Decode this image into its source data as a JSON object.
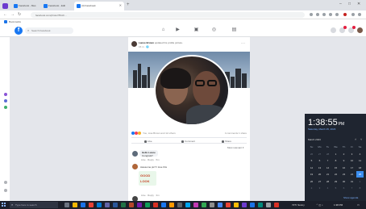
{
  "browser": {
    "tabs": [
      {
        "label": "Facebook - Mes",
        "favicon_color": "#1877f2"
      },
      {
        "label": "Facebook - Edit",
        "favicon_color": "#1877f2"
      },
      {
        "label": "(3) Facebook",
        "favicon_color": "#1877f2",
        "active": true
      }
    ],
    "new_tab": "+",
    "window_controls": [
      "–",
      "□",
      "✕"
    ],
    "address": "facebook.com/photo/?fbid=...",
    "bookmark_label": "Bookmarks"
  },
  "facebook": {
    "logo": "f",
    "search_placeholder": "Search Facebook",
    "nav_icons": [
      "home-icon",
      "video-icon",
      "marketplace-icon",
      "groups-icon",
      "gaming-icon"
    ],
    "post": {
      "author": "Lance Brown",
      "author_action": "updated his profile picture.",
      "timestamp": "16 m · 🌐",
      "more": "···",
      "reactions_text": "You, Lisa Brown and 12 others",
      "comments_shares": "4 comments  1 share",
      "actions": [
        "Like",
        "Comment",
        "Share"
      ],
      "sort_label": "Most relevant ▾",
      "comments": [
        {
          "name": "Hello Lance",
          "text": "Congrats!!",
          "links": "Like · Reply · 5m"
        },
        {
          "name": "",
          "text": "Awesome pic!! I love this",
          "links": ""
        },
        {
          "name": "",
          "text": "",
          "links": "Like · Reply · 3m"
        }
      ],
      "sticker_lines": [
        "GOOD",
        "LOOK"
      ]
    }
  },
  "clock": {
    "time": "1:38:55",
    "seconds_suffix": "PM",
    "date": "Saturday, March 25, 2023",
    "month": "March 2023",
    "weekdays": [
      "Su",
      "Mo",
      "Tu",
      "We",
      "Th",
      "Fr",
      "Sa"
    ],
    "days": [
      [
        "26",
        "27",
        "28",
        "1",
        "2",
        "3",
        "4"
      ],
      [
        "5",
        "6",
        "7",
        "8",
        "9",
        "10",
        "11"
      ],
      [
        "12",
        "13",
        "14",
        "15",
        "16",
        "17",
        "18"
      ],
      [
        "19",
        "20",
        "21",
        "22",
        "23",
        "24",
        "25"
      ],
      [
        "26",
        "27",
        "28",
        "29",
        "30",
        "31",
        "1"
      ],
      [
        "2",
        "3",
        "4",
        "5",
        "6",
        "7",
        "8"
      ]
    ],
    "today": "25",
    "link": "Show agenda"
  },
  "taskbar": {
    "search_placeholder": "Type here to search",
    "tray_text": "72°F Sunny",
    "tray_time": "1:38 PM"
  },
  "colors": {
    "accent": "#1877f2",
    "taskbar": "#1c1f2a",
    "clock_bg": "#1f2530",
    "today": "#3b8ef0"
  }
}
